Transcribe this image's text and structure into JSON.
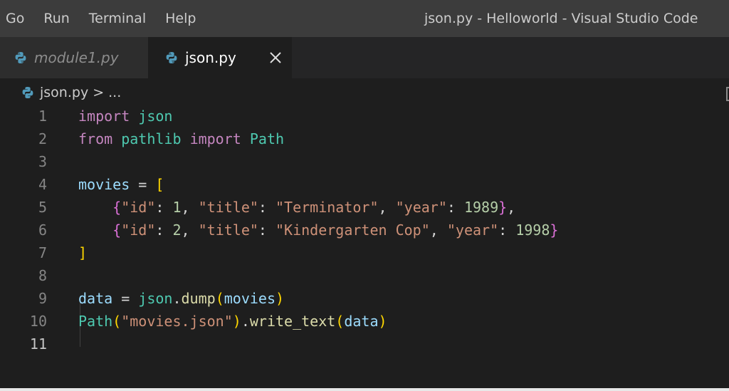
{
  "menu": {
    "items": [
      "Go",
      "Run",
      "Terminal",
      "Help"
    ]
  },
  "window_title": "json.py - Helloworld - Visual Studio Code",
  "tabs": [
    {
      "label": "module1.py",
      "active": false
    },
    {
      "label": "json.py",
      "active": true
    }
  ],
  "breadcrumb": {
    "file": "json.py",
    "separator": ">",
    "more": "..."
  },
  "editor": {
    "line_numbers": [
      "1",
      "2",
      "3",
      "4",
      "5",
      "6",
      "7",
      "8",
      "9",
      "10",
      "11"
    ],
    "current_line": "11",
    "lines": [
      [
        {
          "t": "import",
          "c": "kw"
        },
        {
          "t": " ",
          "c": "op"
        },
        {
          "t": "json",
          "c": "mod"
        }
      ],
      [
        {
          "t": "from",
          "c": "kw"
        },
        {
          "t": " ",
          "c": "op"
        },
        {
          "t": "pathlib",
          "c": "mod"
        },
        {
          "t": " ",
          "c": "op"
        },
        {
          "t": "import",
          "c": "kw"
        },
        {
          "t": " ",
          "c": "op"
        },
        {
          "t": "Path",
          "c": "mod"
        }
      ],
      [],
      [
        {
          "t": "movies",
          "c": "var"
        },
        {
          "t": " = ",
          "c": "op"
        },
        {
          "t": "[",
          "c": "b1"
        }
      ],
      [
        {
          "t": "    ",
          "c": "op"
        },
        {
          "t": "{",
          "c": "b2"
        },
        {
          "t": "\"id\"",
          "c": "str"
        },
        {
          "t": ": ",
          "c": "op"
        },
        {
          "t": "1",
          "c": "num"
        },
        {
          "t": ", ",
          "c": "op"
        },
        {
          "t": "\"title\"",
          "c": "str"
        },
        {
          "t": ": ",
          "c": "op"
        },
        {
          "t": "\"Terminator\"",
          "c": "str"
        },
        {
          "t": ", ",
          "c": "op"
        },
        {
          "t": "\"year\"",
          "c": "str"
        },
        {
          "t": ": ",
          "c": "op"
        },
        {
          "t": "1989",
          "c": "num"
        },
        {
          "t": "}",
          "c": "b2"
        },
        {
          "t": ",",
          "c": "op"
        }
      ],
      [
        {
          "t": "    ",
          "c": "op"
        },
        {
          "t": "{",
          "c": "b2"
        },
        {
          "t": "\"id\"",
          "c": "str"
        },
        {
          "t": ": ",
          "c": "op"
        },
        {
          "t": "2",
          "c": "num"
        },
        {
          "t": ", ",
          "c": "op"
        },
        {
          "t": "\"title\"",
          "c": "str"
        },
        {
          "t": ": ",
          "c": "op"
        },
        {
          "t": "\"Kindergarten Cop\"",
          "c": "str"
        },
        {
          "t": ", ",
          "c": "op"
        },
        {
          "t": "\"year\"",
          "c": "str"
        },
        {
          "t": ": ",
          "c": "op"
        },
        {
          "t": "1998",
          "c": "num"
        },
        {
          "t": "}",
          "c": "b2"
        }
      ],
      [
        {
          "t": "]",
          "c": "b1"
        }
      ],
      [],
      [
        {
          "t": "data",
          "c": "var"
        },
        {
          "t": " = ",
          "c": "op"
        },
        {
          "t": "json",
          "c": "mod"
        },
        {
          "t": ".",
          "c": "op"
        },
        {
          "t": "dump",
          "c": "fn"
        },
        {
          "t": "(",
          "c": "b1"
        },
        {
          "t": "movies",
          "c": "var"
        },
        {
          "t": ")",
          "c": "b1"
        }
      ],
      [
        {
          "t": "Path",
          "c": "mod"
        },
        {
          "t": "(",
          "c": "b1"
        },
        {
          "t": "\"movies.json\"",
          "c": "str"
        },
        {
          "t": ")",
          "c": "b1"
        },
        {
          "t": ".",
          "c": "op"
        },
        {
          "t": "write_text",
          "c": "fn"
        },
        {
          "t": "(",
          "c": "b1"
        },
        {
          "t": "data",
          "c": "var"
        },
        {
          "t": ")",
          "c": "b1"
        }
      ],
      []
    ]
  },
  "colors": {
    "keyword": "#c586c0",
    "module": "#4ec9b0",
    "variable": "#9cdcfe",
    "function": "#dcdcaa",
    "string": "#ce9178",
    "number": "#b5cea8",
    "bracket_1": "#ffd700",
    "bracket_2": "#da70d6"
  },
  "icons": {
    "file_icon": "python-icon",
    "close_icon": "close-icon"
  }
}
